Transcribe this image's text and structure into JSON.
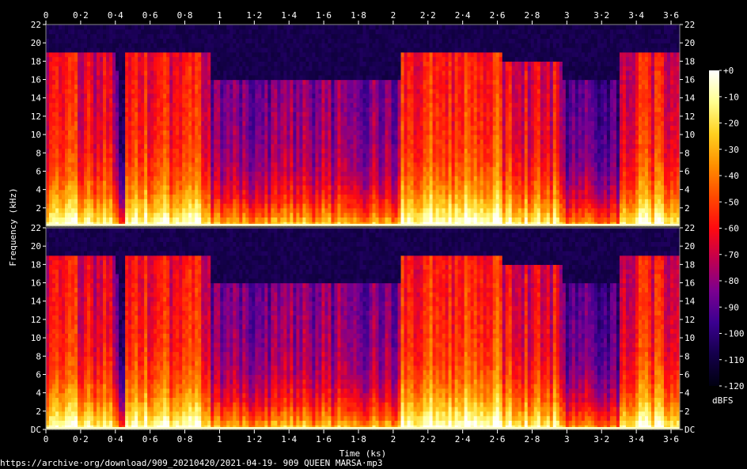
{
  "chart_data": {
    "type": "heatmap",
    "title": "",
    "xlabel": "Time (ks)",
    "ylabel": "Frequency (kHz)",
    "x_ticks": [
      "0",
      "0·2",
      "0·4",
      "0·6",
      "0·8",
      "1",
      "1·2",
      "1·4",
      "1·6",
      "1·8",
      "2",
      "2·2",
      "2·4",
      "2·6",
      "2·8",
      "3",
      "3·2",
      "3·4",
      "3·6"
    ],
    "x_tick_values": [
      0,
      0.2,
      0.4,
      0.6,
      0.8,
      1.0,
      1.2,
      1.4,
      1.6,
      1.8,
      2.0,
      2.2,
      2.4,
      2.6,
      2.8,
      3.0,
      3.2,
      3.4,
      3.6
    ],
    "xlim": [
      0,
      3.65
    ],
    "y_ticks": [
      "22",
      "20",
      "18",
      "16",
      "14",
      "12",
      "10",
      "8",
      "6",
      "4",
      "2"
    ],
    "y_tick_values": [
      22,
      20,
      18,
      16,
      14,
      12,
      10,
      8,
      6,
      4,
      2
    ],
    "y_bottom_label": "DC",
    "ylim": [
      0,
      22
    ],
    "channels": 2,
    "colorbar": {
      "label": "dBFS",
      "ticks": [
        "+0",
        "-10",
        "-20",
        "-30",
        "-40",
        "-50",
        "-60",
        "-70",
        "-80",
        "-90",
        "-100",
        "-110",
        "-120"
      ],
      "tick_values": [
        0,
        -10,
        -20,
        -30,
        -40,
        -50,
        -60,
        -70,
        -80,
        -90,
        -100,
        -110,
        -120
      ],
      "range": [
        -120,
        0
      ],
      "colors": [
        "#000010",
        "#14004a",
        "#3a0090",
        "#7a0090",
        "#c00050",
        "#ff0a10",
        "#ff4a00",
        "#ff9000",
        "#ffd020",
        "#ffff90",
        "#ffffff"
      ]
    },
    "segments": [
      {
        "t0": 0.0,
        "t1": 0.18,
        "level": 0.55,
        "cutoff": 19.0
      },
      {
        "t0": 0.18,
        "t1": 0.4,
        "level": 0.5,
        "cutoff": 19.0
      },
      {
        "t0": 0.4,
        "t1": 0.46,
        "level": 0.25,
        "cutoff": 17.0
      },
      {
        "t0": 0.46,
        "t1": 0.94,
        "level": 0.55,
        "cutoff": 19.0
      },
      {
        "t0": 0.94,
        "t1": 2.04,
        "level": 0.38,
        "cutoff": 16.0
      },
      {
        "t0": 2.04,
        "t1": 2.62,
        "level": 0.6,
        "cutoff": 19.0
      },
      {
        "t0": 2.62,
        "t1": 2.98,
        "level": 0.52,
        "cutoff": 18.0
      },
      {
        "t0": 2.98,
        "t1": 3.3,
        "level": 0.3,
        "cutoff": 16.0
      },
      {
        "t0": 3.3,
        "t1": 3.65,
        "level": 0.55,
        "cutoff": 19.0
      }
    ]
  },
  "footer": "https://archive·org/download/909_20210420/2021-04-19- 909 QUEEN MARSA·mp3"
}
